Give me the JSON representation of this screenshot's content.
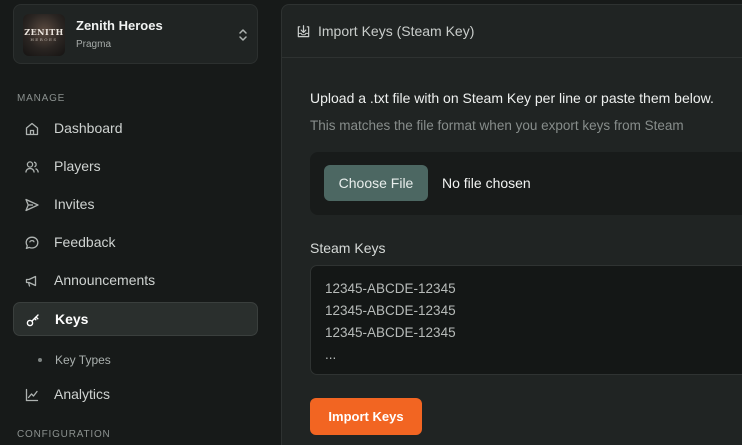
{
  "app": {
    "logo_text": "ZENITH",
    "logo_subtext": "HEROES",
    "name": "Zenith Heroes",
    "org": "Pragma"
  },
  "sidebar": {
    "manage_label": "MANAGE",
    "items": [
      {
        "label": "Dashboard",
        "icon": "home-icon"
      },
      {
        "label": "Players",
        "icon": "users-icon"
      },
      {
        "label": "Invites",
        "icon": "send-icon"
      },
      {
        "label": "Feedback",
        "icon": "message-icon"
      },
      {
        "label": "Announcements",
        "icon": "megaphone-icon"
      },
      {
        "label": "Keys",
        "icon": "key-icon",
        "active": true
      },
      {
        "label": "Analytics",
        "icon": "chart-icon"
      }
    ],
    "sub_items": [
      {
        "label": "Key Types"
      }
    ],
    "configuration_label": "CONFIGURATION"
  },
  "panel": {
    "title": "Import Keys (Steam Key)",
    "instructions": "Upload a .txt file with on Steam Key per line or paste them below.",
    "helper": "This matches the file format when you export keys from Steam",
    "choose_file_label": "Choose File",
    "file_status": "No file chosen",
    "keys_label": "Steam Keys",
    "keys_lines": [
      "12345-ABCDE-12345",
      "12345-ABCDE-12345",
      "12345-ABCDE-12345",
      "..."
    ],
    "import_button": "Import Keys"
  },
  "colors": {
    "accent": "#f26522",
    "secondary_button": "#4c6762",
    "background": "#171a19",
    "panel": "#202423"
  }
}
